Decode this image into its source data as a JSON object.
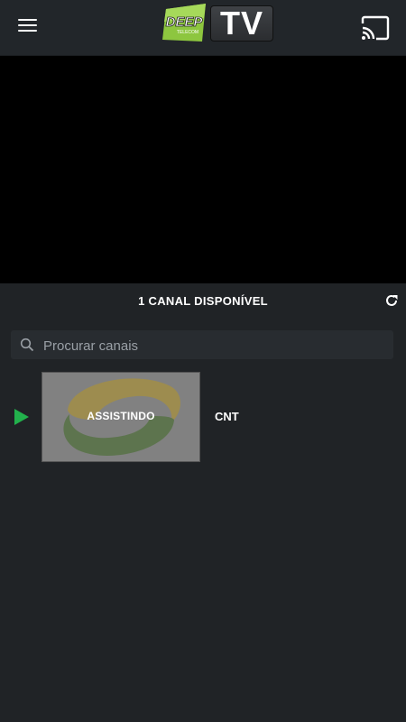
{
  "header": {
    "logo_left_text": "DEEP",
    "logo_sub_text": "TELECOM",
    "logo_tv_text": "TV",
    "menu_icon": "hamburger-menu-icon",
    "cast_icon": "cast-icon"
  },
  "channels": {
    "count_label": "1 CANAL DISPONÍVEL",
    "refresh_icon": "refresh-icon",
    "search": {
      "placeholder": "Procurar canais",
      "value": ""
    },
    "items": [
      {
        "name": "CNT",
        "status_label": "ASSISTINDO",
        "playing": true
      }
    ]
  },
  "colors": {
    "background": "#202326",
    "topbar": "#22262a",
    "accent_green": "#22b14c",
    "logo_green": "#8dc63f"
  }
}
